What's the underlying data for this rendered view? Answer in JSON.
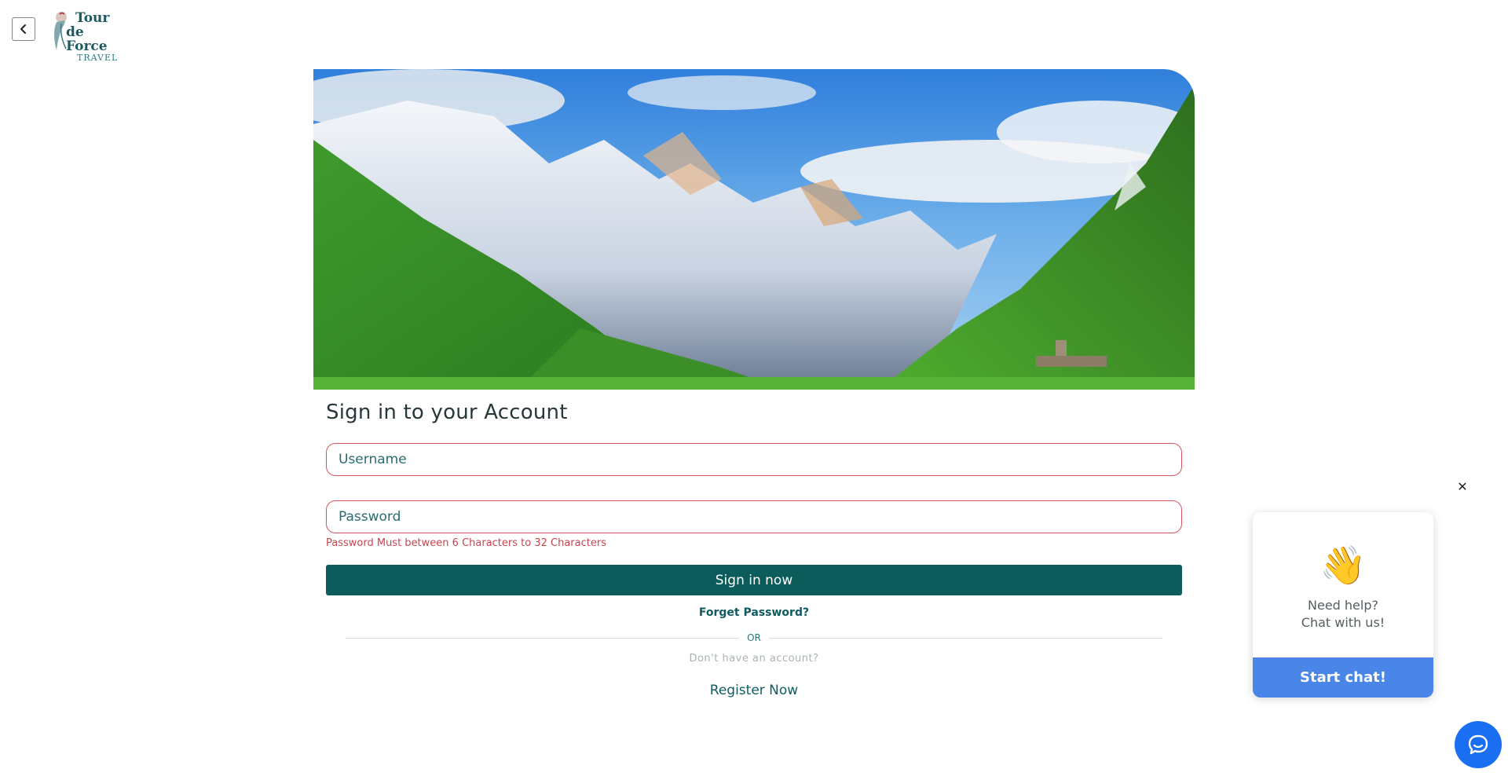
{
  "header": {
    "back_icon": "chevron-left-icon",
    "logo": {
      "line1": "Tour",
      "line2": "de Force",
      "line3": "TRAVEL"
    }
  },
  "hero": {
    "image_desc_icon": "mountain-landscape-image"
  },
  "form": {
    "title": "Sign in to your Account",
    "username_placeholder": "Username",
    "password_placeholder": "Password",
    "password_error": "Password Must between 6 Characters to 32 Characters",
    "signin_label": "Sign in now",
    "forgot_label": "Forget Password?",
    "or_label": "OR",
    "no_account_text": "Don't have an account?",
    "register_label": "Register Now"
  },
  "chat": {
    "close_label": "✕",
    "wave_emoji": "👋",
    "help_line1": "Need help?",
    "help_line2": "Chat with us!",
    "start_label": "Start chat!",
    "launcher_icon": "chat-bubble-icon"
  },
  "colors": {
    "primary": "#0d5c5c",
    "error": "#c8444f",
    "chat_blue": "#4a85e8",
    "launcher_blue": "#1a6ef2"
  }
}
